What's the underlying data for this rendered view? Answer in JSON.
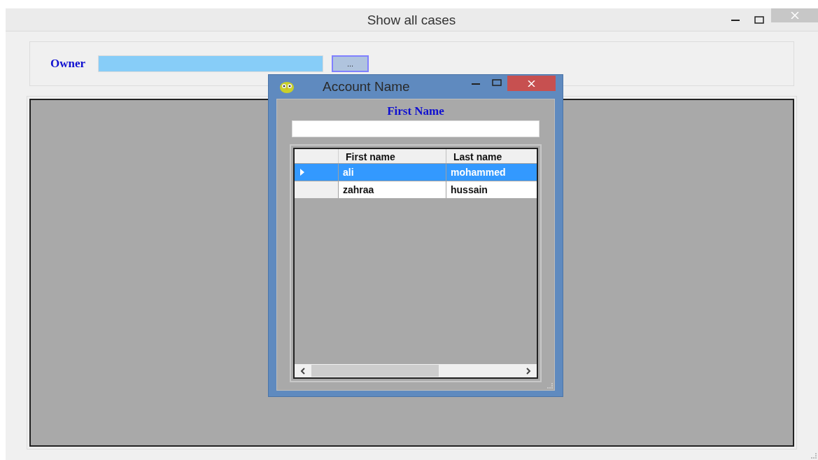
{
  "window": {
    "title": "Show all cases"
  },
  "owner": {
    "label": "Owner",
    "browse_button": "..."
  },
  "dialog": {
    "title": "Account Name",
    "search_label": "First Name",
    "table": {
      "columns": [
        "First name",
        "Last name"
      ],
      "rows": [
        {
          "cells": [
            "ali",
            "mohammed"
          ],
          "selected": true
        },
        {
          "cells": [
            "zahraa",
            "hussain"
          ],
          "selected": false
        }
      ]
    }
  }
}
